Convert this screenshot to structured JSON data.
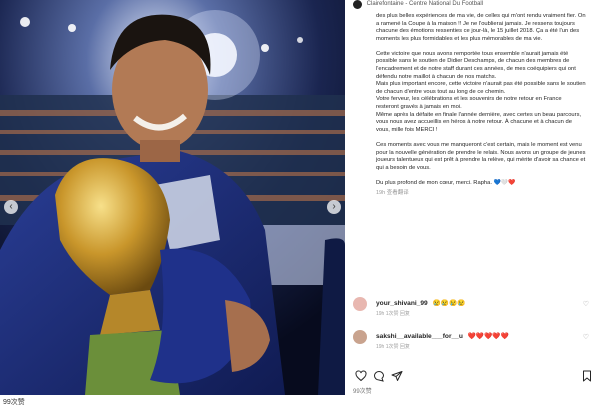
{
  "post": {
    "header_text": "Clairefontaine - Centre National Du Football",
    "caption": [
      "des plus belles expériences de ma vie, de celles qui m'ont rendu vraiment fier. On a ramené la Coupe à la maison !! Je ne l'oublierai jamais. Je ressens toujours chacune des émotions ressenties ce jour-là, le 15 juillet 2018. Ça a été l'un des moments les plus formidables et les plus mémorables de ma vie.",
      "Cette victoire que nous avons remportée tous ensemble n'aurait jamais été possible sans le soutien de Didier Deschamps, de chacun des membres de l'encadrement et de notre staff durant ces années, de mes coéquipiers qui ont défendu notre maillot à chacun de nos matchs.",
      "Mais plus important encore, cette victoire n'aurait pas été possible sans le soutien de chacun d'entre vous tout au long de ce chemin.",
      "Votre ferveur, les célébrations et les souvenirs de notre retour en France resteront gravés à jamais en moi.",
      "Même après la défaite en finale l'année dernière, avec certes un beau parcours, vous nous avez accueillis en héros à notre retour. À chacune et à chacun de vous, mille fois MERCI !",
      "Ces moments avec vous me manqueront c'est certain, mais le moment est venu pour la nouvelle génération de prendre le relais. Nous avons un groupe de jeunes joueurs talentueux qui est prêt à prendre la relève, qui mérite d'avoir sa chance et qui a besoin de vous.",
      "Du plus profond de mon cœur, merci. Rapha. 💙🤍❤️"
    ],
    "caption_meta": "19h   查看翻译",
    "likes_text": "99次赞",
    "footer_count": "99次赞"
  },
  "comments": [
    {
      "user": "your_shivani_99",
      "text": "😢😢😢😢",
      "meta": "19h   1次赞   回复",
      "avatar_color": "#e8b7b0"
    },
    {
      "user": "sakshi__available___for__u",
      "text": "❤️❤️❤️❤️❤️",
      "meta": "19h   1次赞   回复",
      "avatar_color": "#c9a38e"
    }
  ],
  "icons": {
    "like": "heart-icon",
    "comment": "comment-icon",
    "share": "send-icon",
    "save": "bookmark-icon"
  },
  "colors": {
    "jersey": "#1d2f7a",
    "trophy": "#c9962b",
    "background_stadium": "#0c1430"
  }
}
